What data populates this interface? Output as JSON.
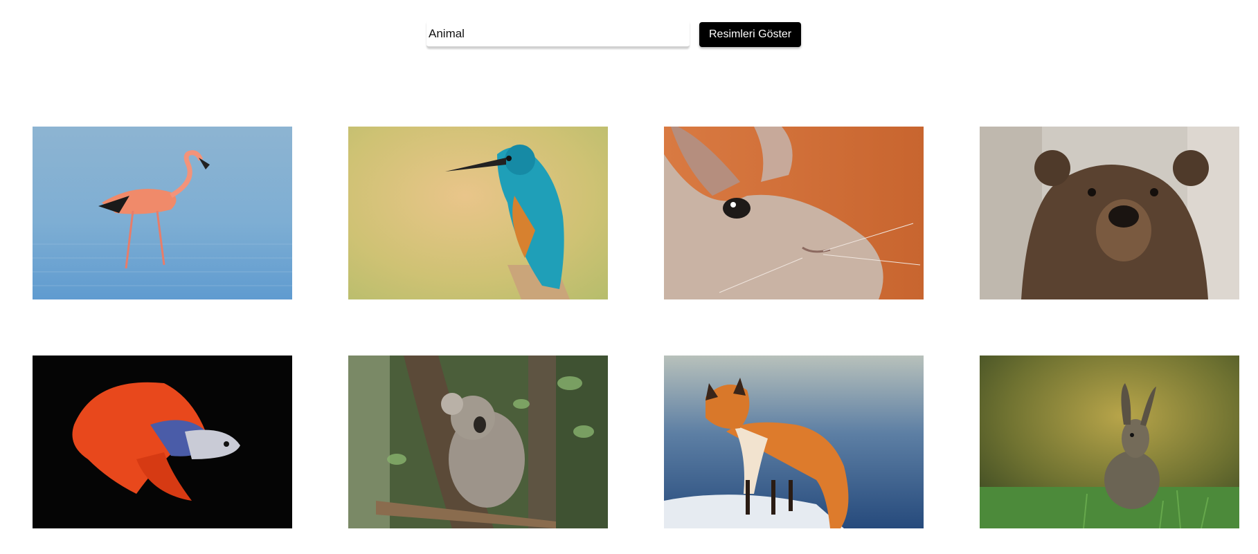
{
  "search": {
    "value": "Animal",
    "button_label": "Resimleri Göster"
  },
  "gallery": {
    "images": [
      {
        "subject": "flamingo-image"
      },
      {
        "subject": "kingfisher-image"
      },
      {
        "subject": "rabbit-closeup-image"
      },
      {
        "subject": "brown-bear-image"
      },
      {
        "subject": "betta-fish-image"
      },
      {
        "subject": "koala-image"
      },
      {
        "subject": "red-fox-image"
      },
      {
        "subject": "wild-rabbit-image"
      }
    ]
  }
}
